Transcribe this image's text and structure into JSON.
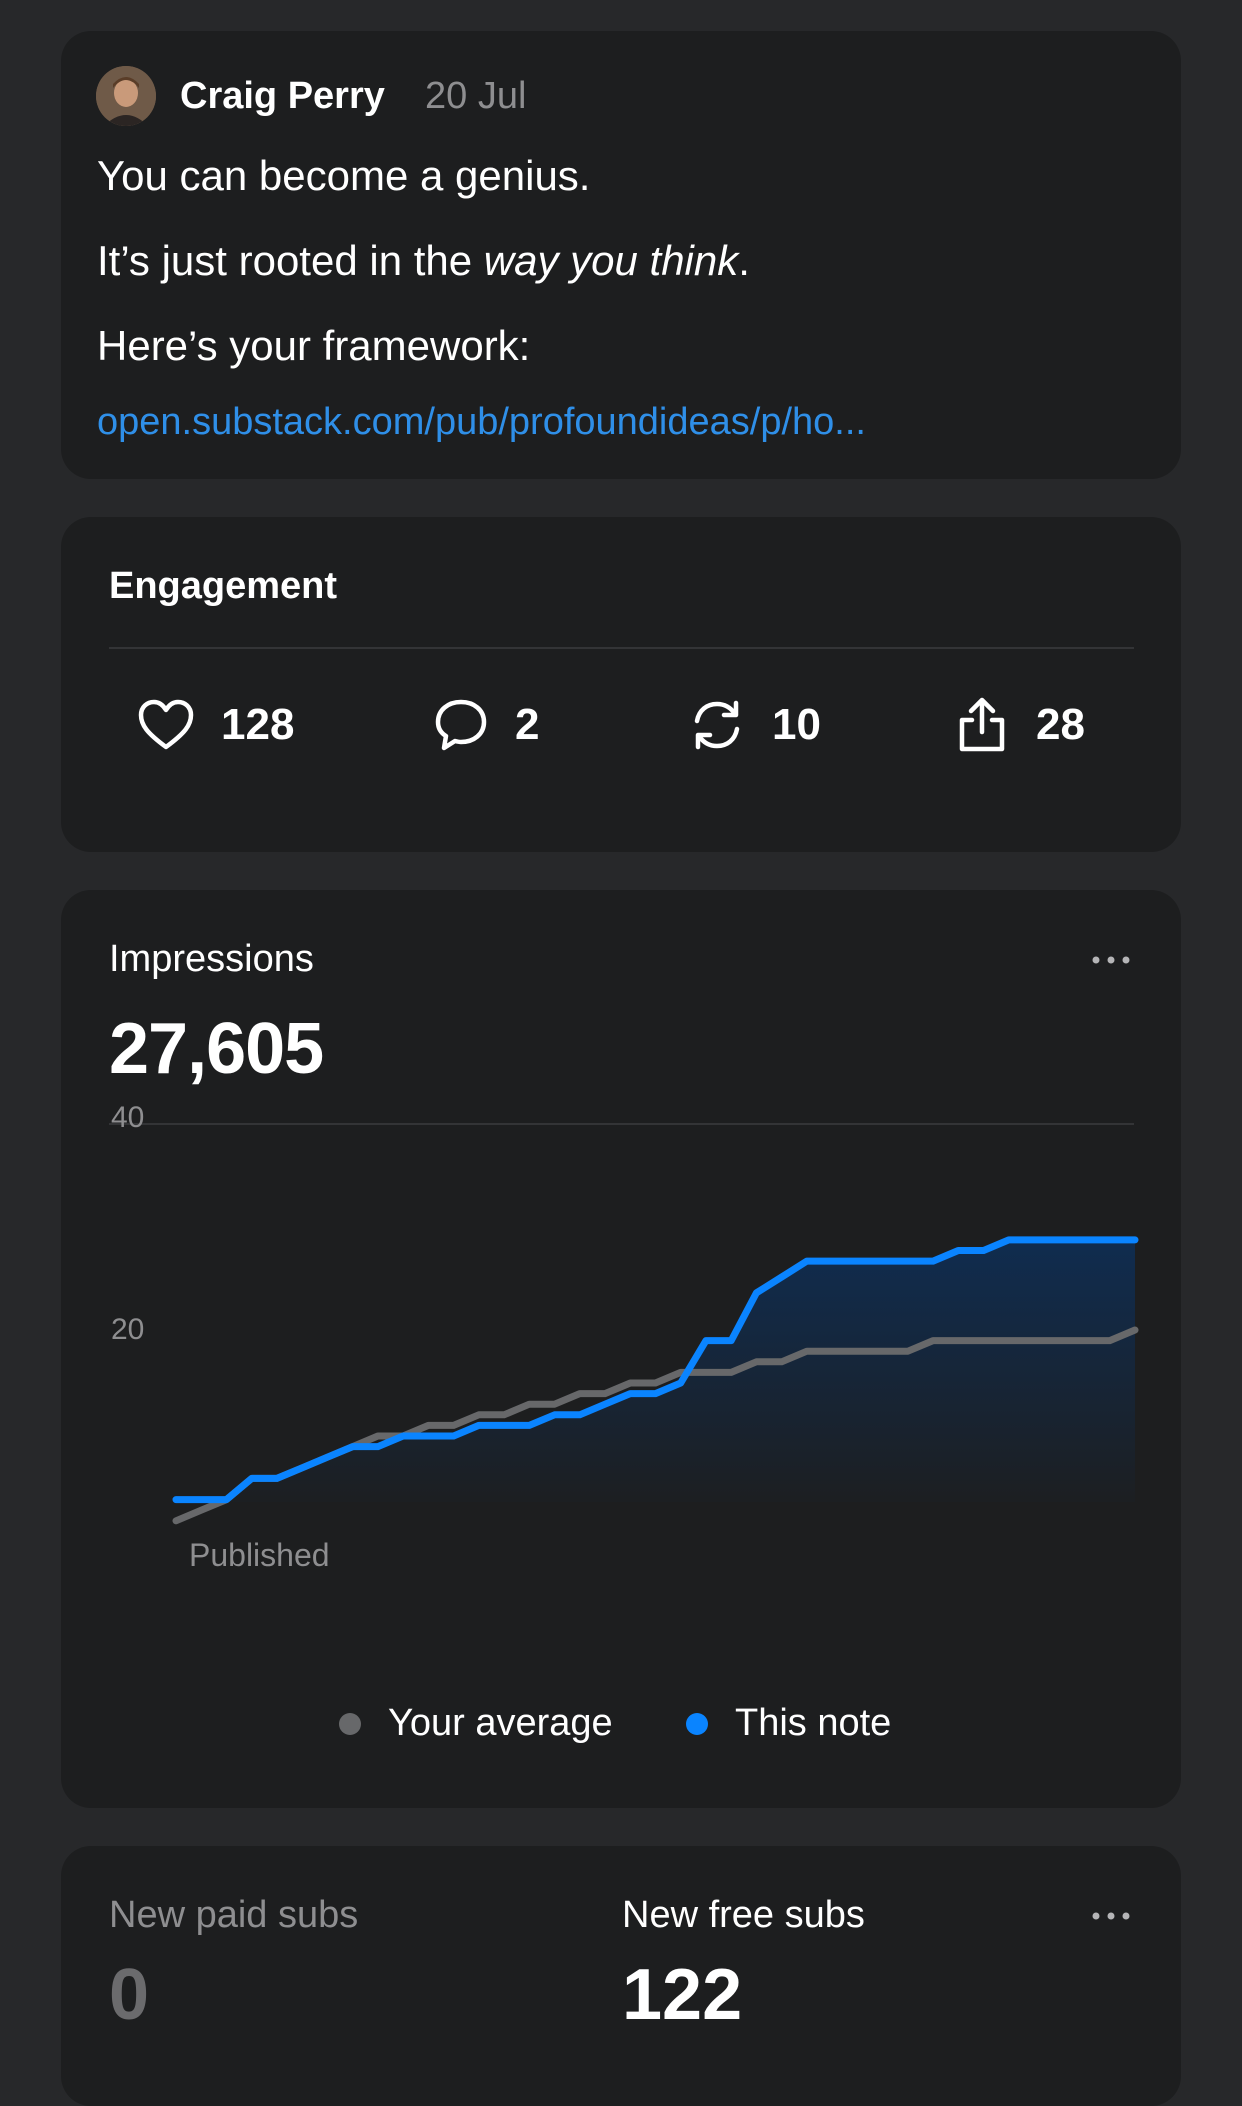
{
  "note": {
    "author": "Craig Perry",
    "date": "20 Jul",
    "line1": "You can become a genius.",
    "line2_prefix": "It’s just rooted in the ",
    "line2_italic": "way you think",
    "line2_suffix": ".",
    "line3": "Here’s your framework:",
    "link_text": "open.substack.com/pub/profoundideas/p/ho..."
  },
  "engagement": {
    "title": "Engagement",
    "likes": "128",
    "comments": "2",
    "restacks": "10",
    "shares": "28",
    "icons": [
      "heart-icon",
      "comment-icon",
      "restack-icon",
      "share-icon"
    ]
  },
  "impressions": {
    "title": "Impressions",
    "total": "27,605"
  },
  "chart_data": {
    "type": "area",
    "y_ticks": [
      "40",
      "20"
    ],
    "ylim": [
      0,
      40
    ],
    "x_label": "Published",
    "series": [
      {
        "name": "Your average",
        "color": "#67686a",
        "values": [
          2,
          3,
          4,
          6,
          6,
          7,
          8,
          9,
          10,
          10,
          11,
          11,
          12,
          12,
          13,
          13,
          14,
          14,
          15,
          15,
          16,
          16,
          16,
          17,
          17,
          18,
          18,
          18,
          18,
          18,
          19,
          19,
          19,
          19,
          19,
          19,
          19,
          19,
          20
        ]
      },
      {
        "name": "This note",
        "color": "#0a84ff",
        "values": [
          4,
          4,
          4,
          6,
          6,
          7,
          8,
          9,
          9,
          10,
          10,
          10,
          11,
          11,
          11,
          12,
          12,
          13,
          14,
          14,
          15,
          19,
          19,
          23.5,
          25,
          26.5,
          26.5,
          26.5,
          26.5,
          26.5,
          26.5,
          27.5,
          27.5,
          28.5,
          28.5,
          28.5,
          28.5,
          28.5,
          28.5
        ]
      }
    ]
  },
  "subs": {
    "paid_label": "New paid subs",
    "paid_value": "0",
    "free_label": "New free subs",
    "free_value": "122"
  },
  "colors": {
    "background": "#27282a",
    "card": "#1d1e1f",
    "accent_blue": "#0a84ff",
    "link": "#2f8fe8",
    "muted": "#8e8e90"
  }
}
